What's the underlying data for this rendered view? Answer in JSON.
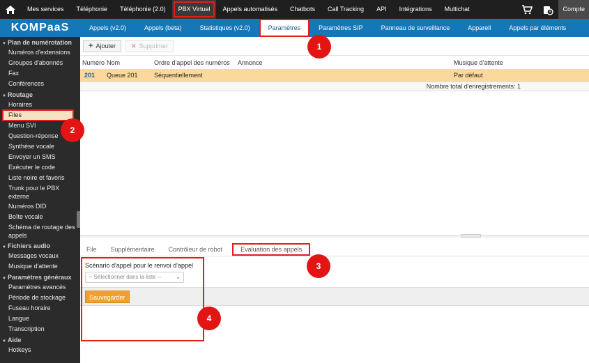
{
  "topnav": {
    "items": [
      {
        "label": "Mes services",
        "highlighted": false
      },
      {
        "label": "Téléphonie",
        "highlighted": false
      },
      {
        "label": "Téléphonie (2.0)",
        "highlighted": false
      },
      {
        "label": "PBX Virtuel",
        "highlighted": true
      },
      {
        "label": "Appels automatisés",
        "highlighted": false
      },
      {
        "label": "Chatbots",
        "highlighted": false
      },
      {
        "label": "Call Tracking",
        "highlighted": false
      },
      {
        "label": "API",
        "highlighted": false
      },
      {
        "label": "Intégrations",
        "highlighted": false
      },
      {
        "label": "Multichat",
        "highlighted": false
      }
    ],
    "account_label": "Compte"
  },
  "logo": "KOMPaaS",
  "subnav": {
    "tabs": [
      {
        "label": "Appels (v2.0)"
      },
      {
        "label": "Appels (beta)"
      },
      {
        "label": "Statistiques (v2.0)"
      },
      {
        "label": "Paramètres"
      },
      {
        "label": "Paramètres SIP"
      },
      {
        "label": "Panneau de surveillance"
      },
      {
        "label": "Appareil"
      },
      {
        "label": "Appels par éléments"
      }
    ],
    "active_tab": "Paramètres"
  },
  "sidebar": {
    "sections": [
      {
        "title": "Plan de numérotation",
        "items": [
          "Numéros d'extensions",
          "Groupes d'abonnés",
          "Fax",
          "Conférences"
        ]
      },
      {
        "title": "Routage",
        "items": [
          "Horaires",
          "Files",
          "Menu SVI",
          "Question-réponse",
          "Synthèse vocale",
          "Envoyer un SMS",
          "Exécuter le code",
          "Liste noire et favoris",
          "Trunk pour le PBX externe",
          "Numéros DID",
          "Boîte vocale",
          "Schéma de routage des appels"
        ]
      },
      {
        "title": "Fichiers audio",
        "items": [
          "Messages vocaux",
          "Musique d'attente"
        ]
      },
      {
        "title": "Paramètres généraux",
        "items": [
          "Paramètres avancés",
          "Période de stockage",
          "Fuseau horaire",
          "Langue",
          "Transcription"
        ]
      },
      {
        "title": "Aide",
        "items": [
          "Hotkeys"
        ]
      }
    ],
    "active_item": "Files"
  },
  "toolbar": {
    "add_label": "Ajouter",
    "delete_label": "Supprimer"
  },
  "grid": {
    "columns": [
      "Numéro",
      "Nom",
      "Ordre d'appel des numéros",
      "Annonce",
      "Musique d'attente"
    ],
    "rows": [
      {
        "numero": "201",
        "nom": "Queue 201",
        "ordre": "Séquentiellement",
        "annonce": "",
        "musique": "Par défaut"
      }
    ],
    "total_label": "Nombre total d'enregistrements: 1"
  },
  "panel": {
    "tabs": [
      "File",
      "Supplémentaire",
      "Contrôleur de robot",
      "Evaluation des appels"
    ],
    "active_tab": "Evaluation des appels",
    "field_label": "Scénario d'appel pour le renvoi d'appel",
    "select_placeholder": "-- Sélectionner dans la liste --",
    "save_label": "Sauvegarder"
  },
  "callouts": [
    "1",
    "2",
    "3",
    "4"
  ],
  "colors": {
    "topnav_bg": "#1f1f1f",
    "subnav_bg": "#1477b8",
    "sidebar_bg": "#2b2b2b",
    "selected_row": "#fbd89b",
    "save_button": "#f0a033",
    "highlight_red": "#e31d1d"
  }
}
